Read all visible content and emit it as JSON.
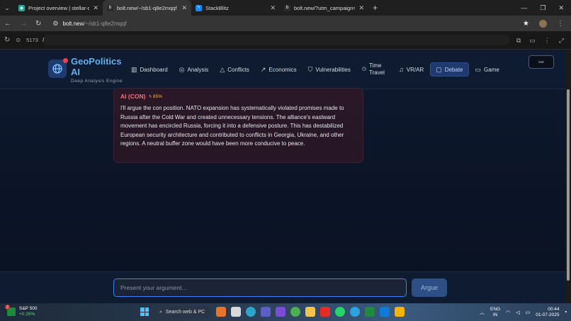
{
  "browser": {
    "tabs": [
      {
        "title": "Project overview | stellar-dange",
        "fav_color": "#26a69a",
        "active": false
      },
      {
        "title": "bolt.new/~/sb1-q8e2mqqf",
        "fav_color": "#2b2b2b",
        "active": true
      },
      {
        "title": "StackBlitz",
        "fav_color": "#1389fd",
        "active": false
      },
      {
        "title": "bolt.new/?utm_campaign=stack",
        "fav_color": "#2b2b2b",
        "active": false
      }
    ],
    "new_tab": "+",
    "url_host": "bolt.new",
    "url_path": "/~/sb1-q8e2mqqf",
    "dev_port": "5173",
    "dev_path": "/"
  },
  "header": {
    "brand": "GeoPolitics AI",
    "tagline": "Deep Analysis Engine",
    "badge_text": "bolt",
    "nav": [
      {
        "label": "Dashboard",
        "icon": "bar-chart-icon"
      },
      {
        "label": "Analysis",
        "icon": "brain-icon"
      },
      {
        "label": "Conflicts",
        "icon": "warning-icon"
      },
      {
        "label": "Economics",
        "icon": "trend-icon"
      },
      {
        "label": "Vulnerabilities",
        "icon": "shield-icon"
      },
      {
        "label": "Time Travel",
        "icon": "clock-icon"
      },
      {
        "label": "VR/AR",
        "icon": "headset-icon"
      },
      {
        "label": "Debate",
        "icon": "chat-icon",
        "active": true
      },
      {
        "label": "Game",
        "icon": "gamepad-icon"
      }
    ]
  },
  "message": {
    "role": "AI (CON)",
    "confidence": "85%",
    "text": "I'll argue the con position. NATO expansion has systematically violated promises made to Russia after the Cold War and created unnecessary tensions. The alliance's eastward movement has encircled Russia, forcing it into a defensive posture. This has destabilized European security architecture and contributed to conflicts in Georgia, Ukraine, and other regions. A neutral buffer zone would have been more conducive to peace."
  },
  "composer": {
    "placeholder": "Present your argument...",
    "value": "",
    "send_label": "Argue"
  },
  "taskbar": {
    "stock_name": "S&P 500",
    "stock_change": "+0.26%",
    "stock_badge": "2",
    "search_label": "Search web & PC",
    "lang_top": "ENG",
    "lang_bottom": "IN",
    "time": "00:44",
    "date": "01-07-2025"
  },
  "colors": {
    "accent": "#3b82f6",
    "con_role": "#f87171",
    "confidence": "#f5b942",
    "brand": "#5eb0f0"
  }
}
